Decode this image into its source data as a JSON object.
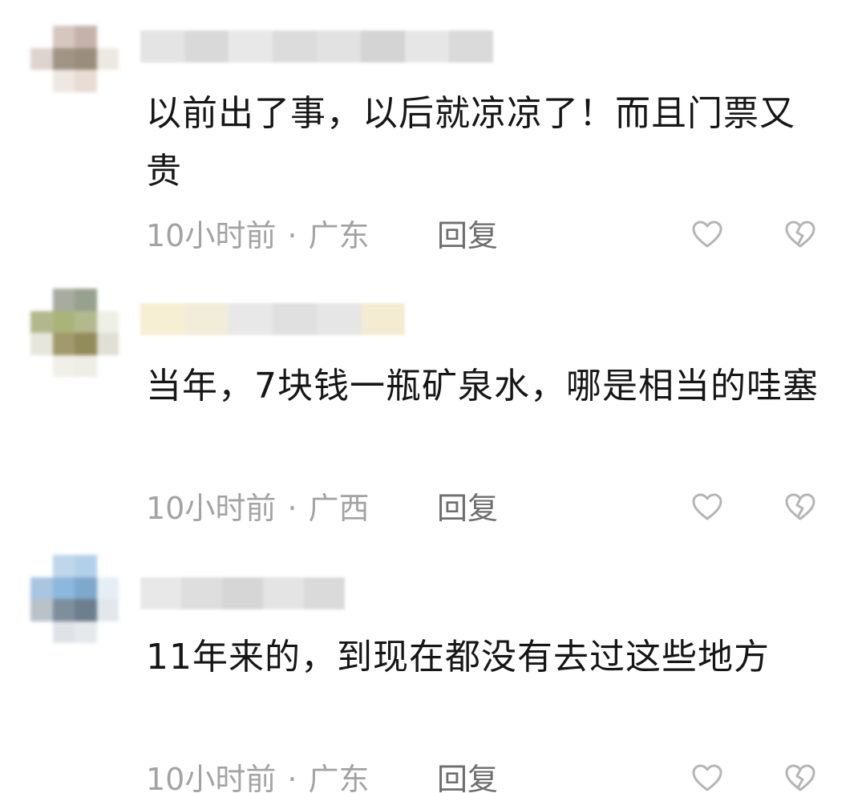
{
  "comments": [
    {
      "text": "以前出了事，以后就凉凉了！而且门票又贵",
      "time": "10小时前",
      "separator": "·",
      "location": "广东",
      "reply_label": "回复",
      "avatar_colors": [
        "#ffffff",
        "#d6c6c0",
        "#c5b3ab",
        "#ffffff",
        "#ddd3cf",
        "#a09484",
        "#9b8d7e",
        "#eee8e3",
        "#ffffff",
        "#efe7e2",
        "#e8dcd4",
        "#ffffff",
        "#ffffff",
        "#ffffff",
        "#ffffff",
        "#ffffff"
      ]
    },
    {
      "text": "当年，7块钱一瓶矿泉水，哪是相当的哇塞",
      "time": "10小时前",
      "separator": "·",
      "location": "广西",
      "reply_label": "回复",
      "avatar_colors": [
        "#ffffff",
        "#a8aba0",
        "#98a08e",
        "#ffffff",
        "#b3b88c",
        "#aab47a",
        "#b2b98d",
        "#eef0e6",
        "#e6e6dc",
        "#a09a6e",
        "#928b5c",
        "#dfdfd5",
        "#ffffff",
        "#f0efe8",
        "#eeede6",
        "#ffffff"
      ]
    },
    {
      "text": "11年来的，到现在都没有去过这些地方",
      "time": "10小时前",
      "separator": "·",
      "location": "广东",
      "reply_label": "回复",
      "avatar_colors": [
        "#ffffff",
        "#c0d6ea",
        "#b3d0ea",
        "#ffffff",
        "#a9c5e0",
        "#8cb8de",
        "#7ea8cc",
        "#e6eef5",
        "#b9c2c9",
        "#7f8e9b",
        "#6d7f8e",
        "#e2e7ec",
        "#ffffff",
        "#dfe3e7",
        "#e6e9ec",
        "#ffffff"
      ]
    }
  ],
  "colors": {
    "text": "#161616",
    "meta": "#a3a3a3",
    "reply": "#6e6e6e",
    "icon": "#b5b5b5"
  },
  "icons": {
    "like": "heart-outline-icon",
    "dislike": "broken-heart-icon"
  }
}
